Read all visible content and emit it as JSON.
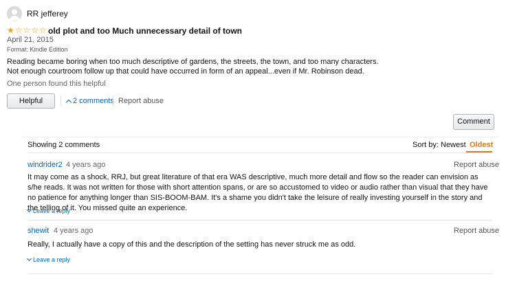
{
  "review": {
    "reviewer": "RR jefferey",
    "rating": 1,
    "max_rating": 5,
    "title": "old plot and too Much unnecessary detail of town",
    "date": "April 21, 2015",
    "format": "Format: Kindle Edition",
    "body_line1": "Reading became boring when too much descriptive of gardens, the streets, the town, and too many characters.",
    "body_line2": "Not enough courtroom follow up that could have occurred in form of an appeal...even if Mr. Robinson dead.",
    "helpful_count_text": "One person found this helpful",
    "helpful_button": "Helpful",
    "comments_link": "2 comments",
    "report_abuse": "Report abuse"
  },
  "comment_button": "Comment",
  "comments_panel": {
    "showing": "Showing 2 comments",
    "sort_by": "Sort by:",
    "sort_newest": "Newest",
    "sort_oldest": "Oldest",
    "comments": [
      {
        "author": "windrider2",
        "time": "4 years ago",
        "report": "Report abuse",
        "text": "It may come as a shock, RRJ, but great literature of that era WAS descriptive, much more detail and flow so the reader can envision as s/he reads. It was not written for those with short attention spans, or are so accustomed to video or audio rather than visual that they have no patience for anything longer than SIS-BOOM-BAM. It's a shame you didn't take the leisure of really investing yourself in the story and the telling of it. You missed quite an experience.",
        "reply": "Leave a reply"
      },
      {
        "author": "shewit",
        "time": "4 years ago",
        "report": "Report abuse",
        "text": "Really, I actually have a copy of this and the description of the setting has never struck me as odd.",
        "reply": "Leave a reply"
      }
    ]
  },
  "colors": {
    "link": "#0066c0",
    "star": "#f5a21b",
    "sort_active": "#e47911"
  }
}
